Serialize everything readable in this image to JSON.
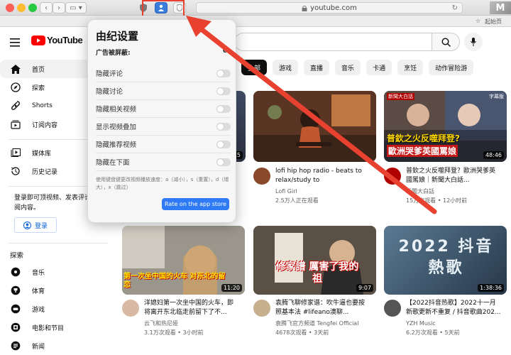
{
  "browser": {
    "address": "youtube.com",
    "bookmark": "起始页"
  },
  "youtube": {
    "logo": "YouTube",
    "search_placeholder": "",
    "chips": [
      "全部",
      "游戏",
      "直播",
      "音乐",
      "卡通",
      "烹饪",
      "动作冒险游"
    ],
    "sidebar": {
      "items": [
        "首页",
        "探索",
        "Shorts",
        "订阅内容"
      ],
      "library": [
        "媒体库",
        "历史记录"
      ],
      "signin_text": "登录即可顶视频、发表评论和订阅内容。",
      "signin_button": "登录",
      "explore_heading": "探索",
      "explore_items": [
        "音乐",
        "体育",
        "游戏",
        "电影和节目",
        "新闻"
      ]
    },
    "videos_row1": [
      {
        "title": "",
        "channel": "",
        "meta": "",
        "duration": "15"
      },
      {
        "title": "lofi hip hop radio - beats to relax/study to",
        "channel": "Lofi Girl",
        "meta": "2.5万人正在观看",
        "duration": ""
      },
      {
        "title": "普欽之火反噬拜登？歐洲哭爹英國罵娘｜新聞大白話...",
        "channel": "新聞大白話",
        "meta": "15万次观看 • 12小时前",
        "duration": "48:46"
      }
    ],
    "thumb3_text": {
      "line1": "普欽之火反噬拜登?",
      "line2": "歐洲哭爹英國罵娘",
      "tag": "新聞大白話",
      "date": "字幕版"
    },
    "videos_row2": [
      {
        "title": "洋媳妇第一次坐中国的火车，即将离开东北临走前留下了不...",
        "channel": "云飞和热尼娅",
        "meta": "3.1万次观看 • 3小时前",
        "duration": "11:20",
        "overlay": "第一次坐中国的火车 对东北的留恋"
      },
      {
        "title": "袁腾飞聊修家谱：吹牛逼也要按照基本法 #lifeano澳聊...",
        "channel": "袁腾飞官方频道 Tengfei Official",
        "meta": "4678次观看 • 3天前",
        "duration": "9:07",
        "overlay": "修家譜 厲害了我的祖"
      },
      {
        "title": "【2022抖音热歌】2022十一月新歌更新不重复 / 抖音歌曲202...",
        "channel": "YZH Music",
        "meta": "6.2万次观看 • 5天前",
        "duration": "1:38:36",
        "overlay": "2022 抖音熱歌"
      }
    ]
  },
  "popover": {
    "title": "由纪设置",
    "subtitle": "广告被屏蔽:",
    "subtitle_value": "0",
    "options": [
      "隐藏评论",
      "隐藏讨论",
      "隐藏相关视频",
      "显示视频叠加",
      "隐藏推荐视频",
      "隐藏在下面"
    ],
    "hint": "使用键盘键更改视频播放速度：a（减小），s（重置），d（增大），x（跳过）",
    "rate_button": "Rate on the app store"
  },
  "colors": {
    "youtube_red": "#ff0000",
    "annotation_red": "#e8412f",
    "rate_blue": "#2f7bf5"
  }
}
